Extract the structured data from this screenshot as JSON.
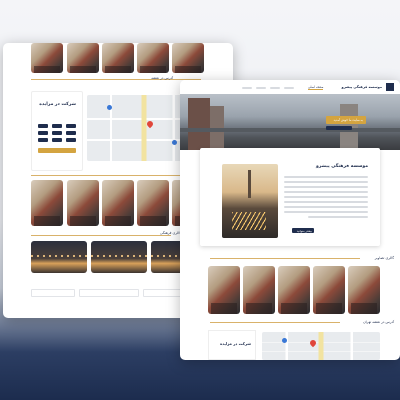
{
  "back_window": {
    "auction_title": "شرکت در مزایده",
    "map_section_title": "آدرس در نقشه",
    "gallery_section_title": "گالری فرهنگی"
  },
  "front_window": {
    "header": {
      "logo_text": "موسسه فرهنگی پیشرو",
      "nav_active": "صفحه اصلی"
    },
    "hero": {
      "banner_text": "به سایت ما خوش آمدید"
    },
    "about": {
      "title": "موسسه فرهنگی پیشرو",
      "read_more": "بیشتر بخوانید"
    },
    "sections": {
      "gallery_title": "گالری تصاویر",
      "map_title": "آدرس در نقشه تهران",
      "auction_title": "شرکت در مزایده"
    }
  },
  "colors": {
    "navy": "#1f2d4d",
    "gold": "#d4a440",
    "background_dark": "#1c2c4e"
  }
}
